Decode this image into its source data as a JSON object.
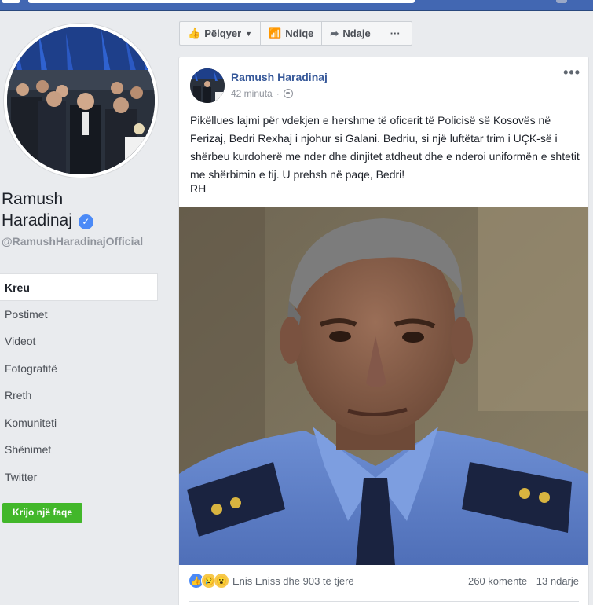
{
  "page": {
    "name_line1": "Ramush",
    "name_line2": "Haradinaj",
    "handle": "@RamushHaradinajOfficial"
  },
  "nav": {
    "items": [
      {
        "label": "Kreu",
        "active": true
      },
      {
        "label": "Postimet"
      },
      {
        "label": "Videot"
      },
      {
        "label": "Fotografitë"
      },
      {
        "label": "Rreth"
      },
      {
        "label": "Komuniteti"
      },
      {
        "label": "Shënimet"
      },
      {
        "label": "Twitter"
      }
    ],
    "create_page": "Krijo një faqe"
  },
  "actions": {
    "like": "Pëlqyer",
    "follow": "Ndiqe",
    "share": "Ndaje",
    "more": "···"
  },
  "post": {
    "author": "Ramush Haradinaj",
    "time": "42 minuta",
    "text": "Pikëllues lajmi për vdekjen e hershme të oficerit të Policisë së Kosovës në Ferizaj, Bedri Rexhaj i njohur si Galani. Bedriu, si një luftëtar trim i UÇK-së i shërbeu kurdoherë me nder dhe dinjitet atdheut dhe e nderoi uniformën e shtetit me shërbimin e tij. U prehsh në paqe, Bedri!",
    "signature": "RH",
    "more": "•••",
    "reactions": {
      "icons": [
        "like-icon",
        "sad-icon",
        "wow-icon"
      ],
      "reactors": "Enis Eniss dhe 903 të tjerë",
      "comments": "260 komente",
      "shares": "13 ndarje"
    }
  },
  "colors": {
    "topbar": "#4267b2",
    "link": "#365899",
    "create_button": "#42b72a",
    "background": "#e9ebee"
  }
}
